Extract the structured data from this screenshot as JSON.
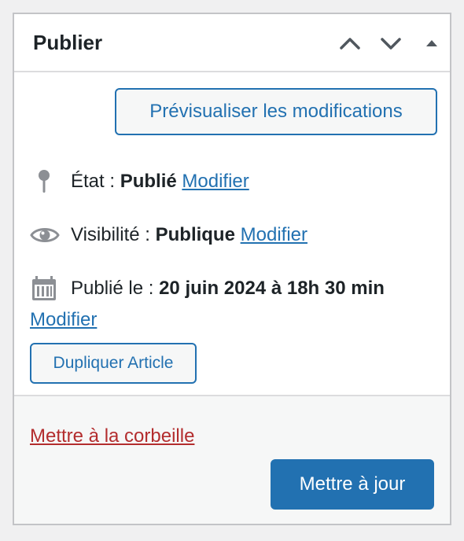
{
  "panel": {
    "title": "Publier",
    "controls": {
      "move_up_icon": "chevron-up-icon",
      "move_down_icon": "chevron-down-icon",
      "toggle_icon": "caret-up-icon"
    }
  },
  "preview": {
    "label": "Prévisualiser les modifications"
  },
  "status": {
    "icon": "pin-icon",
    "label": "État : ",
    "value": "Publié",
    "edit_label": "Modifier"
  },
  "visibility": {
    "icon": "eye-icon",
    "label": "Visibilité : ",
    "value": "Publique",
    "edit_label": "Modifier"
  },
  "published": {
    "icon": "calendar-icon",
    "label": "Publié le : ",
    "value": "20 juin 2024 à 18h 30 min",
    "edit_label": "Modifier"
  },
  "duplicate": {
    "label": "Dupliquer Article"
  },
  "footer": {
    "trash_label": "Mettre à la corbeille",
    "update_label": "Mettre à jour"
  },
  "colors": {
    "accent": "#2271b1",
    "danger": "#b32d2e",
    "text": "#1d2327",
    "icon": "#8c8f94",
    "border": "#c3c4c7",
    "footer_bg": "#f6f7f7"
  }
}
